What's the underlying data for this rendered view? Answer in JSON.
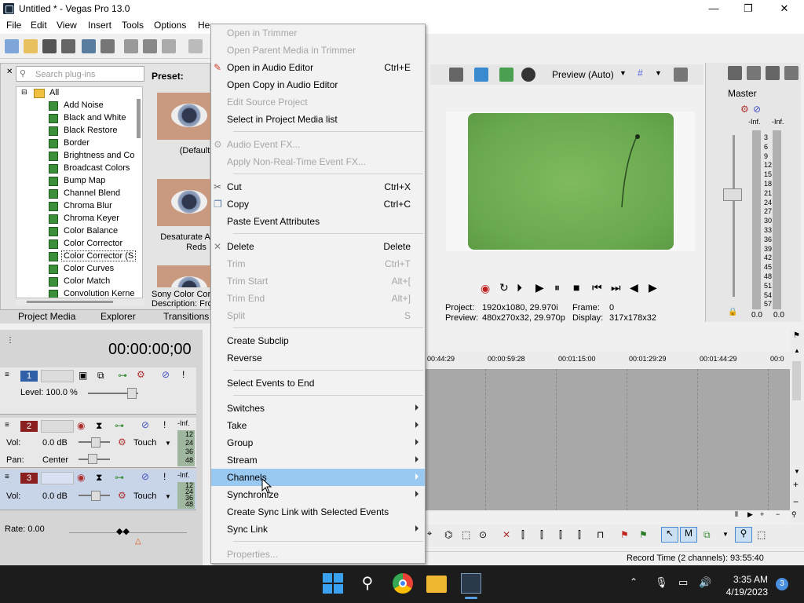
{
  "window": {
    "title": "Untitled * - Vegas Pro 13.0",
    "min": "—",
    "max": "❐",
    "close": "✕"
  },
  "menubar": [
    "File",
    "Edit",
    "View",
    "Insert",
    "Tools",
    "Options",
    "He"
  ],
  "plugins": {
    "search_placeholder": "Search plug-ins",
    "root": "All",
    "items": [
      "Add Noise",
      "Black and White",
      "Black Restore",
      "Border",
      "Brightness and Co",
      "Broadcast Colors",
      "Bump Map",
      "Channel Blend",
      "Chroma Blur",
      "Chroma Keyer",
      "Color Balance",
      "Color Corrector",
      "Color Corrector (S",
      "Color Curves",
      "Color Match",
      "Convolution Kerne"
    ],
    "selected_index": 12,
    "preset_label": "Preset:",
    "preset_captions": [
      "(Default",
      "Desaturate A",
      "Reds"
    ],
    "description_1": "Sony Color Corr",
    "description_2": "Description: Fro"
  },
  "tabs": [
    "Project Media",
    "Explorer",
    "Transitions"
  ],
  "preview": {
    "mode": "Preview (Auto)",
    "project_label": "Project:",
    "project_value": "1920x1080, 29.970i",
    "frame_label": "Frame:",
    "frame_value": "0",
    "preview_label": "Preview:",
    "preview_value": "480x270x32, 29.970p",
    "display_label": "Display:",
    "display_value": "317x178x32"
  },
  "master": {
    "label": "Master",
    "inf_left": "-Inf.",
    "inf_right": "-Inf.",
    "scale": [
      "3",
      "6",
      "9",
      "12",
      "15",
      "18",
      "21",
      "24",
      "27",
      "30",
      "33",
      "36",
      "39",
      "42",
      "45",
      "48",
      "51",
      "54",
      "57"
    ],
    "bottom_left": "0.0",
    "bottom_right": "0.0"
  },
  "timeline": {
    "timecode": "00:00:00;00",
    "ruler": [
      "00:44:29",
      "00:00:59:28",
      "00:01:15:00",
      "00:01:29:29",
      "00:01:44:29",
      "00:0"
    ],
    "track1": {
      "num": "1",
      "level": "Level: 100.0 %"
    },
    "track2": {
      "num": "2",
      "vol_label": "Vol:",
      "vol": "0.0 dB",
      "pan_label": "Pan:",
      "pan": "Center",
      "mode": "Touch",
      "inf": "-Inf.",
      "meter": [
        "12",
        "24",
        "36",
        "48"
      ]
    },
    "track3": {
      "num": "3",
      "vol_label": "Vol:",
      "vol": "0.0 dB",
      "mode": "Touch",
      "inf": "-Inf.",
      "meter": [
        "12",
        "24",
        "36",
        "48"
      ]
    },
    "rate": "Rate: 0.00"
  },
  "status": {
    "record_time": "Record Time (2 channels): 93:55:40"
  },
  "context_menu": [
    {
      "label": "Open in Trimmer",
      "shortcut": "",
      "disabled": true
    },
    {
      "label": "Open Parent Media in Trimmer",
      "shortcut": "",
      "disabled": true
    },
    {
      "label": "Open in Audio Editor",
      "shortcut": "Ctrl+E",
      "disabled": false,
      "icon": "audio-editor-icon"
    },
    {
      "label": "Open Copy in Audio Editor",
      "shortcut": "",
      "disabled": false
    },
    {
      "label": "Edit Source Project",
      "shortcut": "",
      "disabled": true
    },
    {
      "label": "Select in Project Media list",
      "shortcut": "",
      "disabled": false
    },
    {
      "sep": true
    },
    {
      "label": "Audio Event FX...",
      "shortcut": "",
      "disabled": true,
      "icon": "fx-icon"
    },
    {
      "label": "Apply Non-Real-Time Event FX...",
      "shortcut": "",
      "disabled": true
    },
    {
      "sep": true
    },
    {
      "label": "Cut",
      "shortcut": "Ctrl+X",
      "disabled": false,
      "icon": "scissors-icon"
    },
    {
      "label": "Copy",
      "shortcut": "Ctrl+C",
      "disabled": false,
      "icon": "copy-icon"
    },
    {
      "label": "Paste Event Attributes",
      "shortcut": "",
      "disabled": false
    },
    {
      "sep": true
    },
    {
      "label": "Delete",
      "shortcut": "Delete",
      "disabled": false,
      "icon": "delete-icon"
    },
    {
      "label": "Trim",
      "shortcut": "Ctrl+T",
      "disabled": true
    },
    {
      "label": "Trim Start",
      "shortcut": "Alt+[",
      "disabled": true
    },
    {
      "label": "Trim End",
      "shortcut": "Alt+]",
      "disabled": true
    },
    {
      "label": "Split",
      "shortcut": "S",
      "disabled": true
    },
    {
      "sep": true
    },
    {
      "label": "Create Subclip",
      "shortcut": "",
      "disabled": false
    },
    {
      "label": "Reverse",
      "shortcut": "",
      "disabled": false
    },
    {
      "sep": true
    },
    {
      "label": "Select Events to End",
      "shortcut": "",
      "disabled": false
    },
    {
      "sep": true
    },
    {
      "label": "Switches",
      "shortcut": "",
      "disabled": false,
      "submenu": true
    },
    {
      "label": "Take",
      "shortcut": "",
      "disabled": false,
      "submenu": true
    },
    {
      "label": "Group",
      "shortcut": "",
      "disabled": false,
      "submenu": true
    },
    {
      "label": "Stream",
      "shortcut": "",
      "disabled": false,
      "submenu": true
    },
    {
      "label": "Channels",
      "shortcut": "",
      "disabled": false,
      "submenu": true,
      "highlight": true
    },
    {
      "label": "Synchronize",
      "shortcut": "",
      "disabled": false,
      "submenu": true
    },
    {
      "label": "Create Sync Link with Selected Events",
      "shortcut": "",
      "disabled": false
    },
    {
      "label": "Sync Link",
      "shortcut": "",
      "disabled": false,
      "submenu": true
    },
    {
      "sep": true
    },
    {
      "label": "Properties...",
      "shortcut": "",
      "disabled": true
    }
  ],
  "taskbar": {
    "time": "3:35 AM",
    "date": "4/19/2023",
    "badge": "3"
  }
}
